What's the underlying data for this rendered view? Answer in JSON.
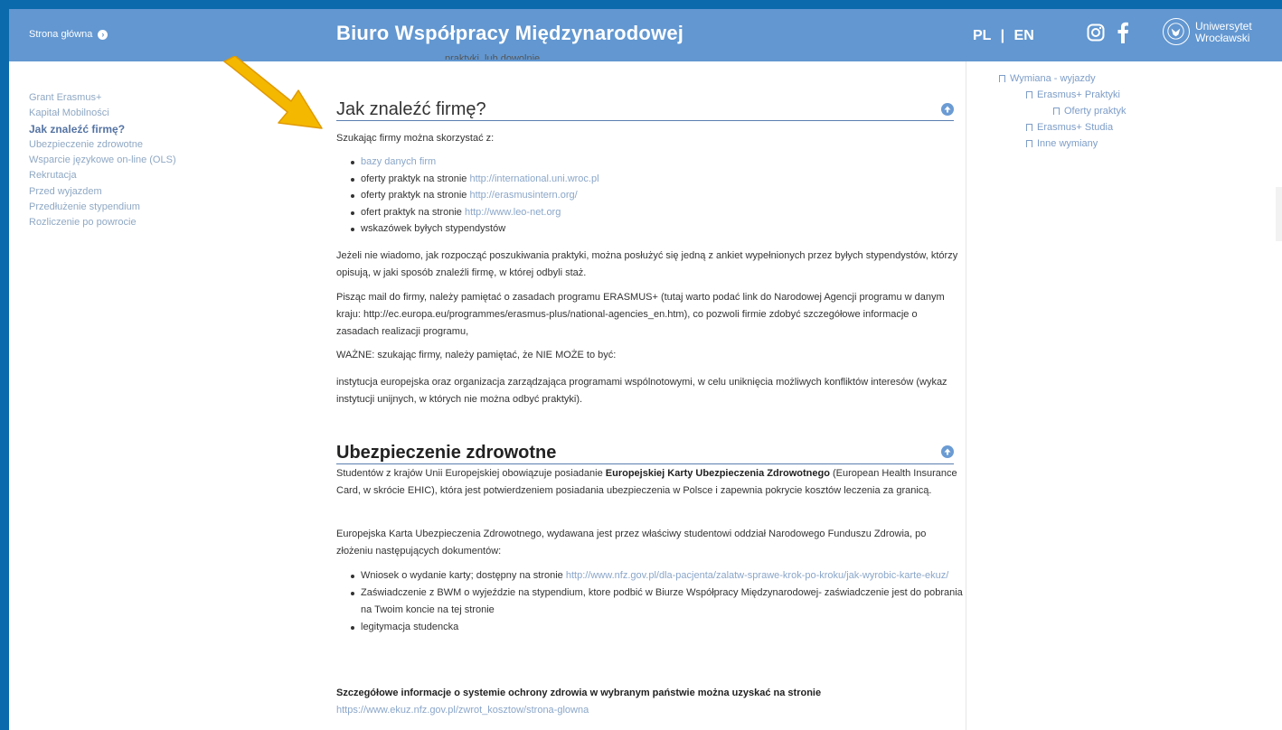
{
  "header": {
    "home_label": "Strona główna",
    "title": "Biuro Współpracy Międzynarodowej",
    "lang_pl": "PL",
    "lang_sep": "|",
    "lang_en": "EN",
    "university_line1": "Uniwersytet",
    "university_line2": "Wrocławski"
  },
  "sidebar": {
    "items": [
      {
        "label": "Grant Erasmus+"
      },
      {
        "label": "Kapitał Mobilności"
      },
      {
        "label": "Jak znaleźć firmę?"
      },
      {
        "label": "Ubezpieczenie zdrowotne"
      },
      {
        "label": "Wsparcie językowe on-line (OLS)"
      },
      {
        "label": "Rekrutacja"
      },
      {
        "label": "Przed wyjazdem"
      },
      {
        "label": "Przedłużenie stypendium"
      },
      {
        "label": "Rozliczenie po powrocie"
      }
    ]
  },
  "right_nav": {
    "items": [
      {
        "label": "Wymiana - wyjazdy"
      },
      {
        "label": "Erasmus+ Praktyki"
      },
      {
        "label": "Oferty praktyk"
      },
      {
        "label": "Erasmus+ Studia"
      },
      {
        "label": "Inne wymiany"
      }
    ]
  },
  "colors": {
    "accent": "#6297d1",
    "frame": "#0a6aab",
    "arrow": "#f5b800"
  },
  "main": {
    "top_cut_text": "praktyki, lub dowolnie",
    "section1": {
      "heading": "Jak znaleźć firmę?",
      "intro": "Szukając firmy można skorzystać z:",
      "list": [
        {
          "text": "",
          "link": "bazy danych firm"
        },
        {
          "text": "oferty praktyk na stronie ",
          "link": "http://international.uni.wroc.pl"
        },
        {
          "text": "oferty praktyk na stronie ",
          "link": "http://erasmusintern.org/"
        },
        {
          "text": "ofert praktyk na stronie ",
          "link": "http://www.leo-net.org"
        },
        {
          "text": "wskazówek byłych stypendystów",
          "link": ""
        }
      ],
      "p1": "Jeżeli nie wiadomo, jak rozpocząć poszukiwania praktyki, można posłużyć się jedną z ankiet wypełnionych przez byłych stypendystów, którzy opisują, w jaki sposób znaleźli firmę, w której odbyli staż.",
      "p2": "Pisząc mail do firmy, należy pamiętać o zasadach programu ERASMUS+ (tutaj warto podać link do Narodowej Agencji programu w danym kraju: http://ec.europa.eu/programmes/erasmus-plus/national-agencies_en.htm), co pozwoli firmie zdobyć szczegółowe informacje o zasadach realizacji programu,",
      "p3": "WAŻNE: szukając firmy, należy pamiętać, że NIE MOŻE to być:",
      "p4": "instytucja europejska oraz organizacja zarządzająca programami wspólnotowymi, w celu uniknięcia możliwych konfliktów interesów (wykaz instytucji unijnych, w których nie można odbyć praktyki)."
    },
    "section2": {
      "heading": "Ubezpieczenie zdrowotne",
      "p1_a": "Studentów z krajów Unii Europejskiej obowiązuje posiadanie ",
      "p1_b": "Europejskiej Karty Ubezpieczenia Zdrowotnego",
      "p1_c": " (European Health Insurance Card, w skrócie EHIC), która jest potwierdzeniem posiadania ubezpieczenia w Polsce i zapewnia pokrycie kosztów leczenia za granicą.",
      "p2": "Europejska Karta Ubezpieczenia Zdrowotnego, wydawana jest przez właściwy studentowi oddział Narodowego Funduszu Zdrowia, po złożeniu następujących dokumentów:",
      "list": [
        {
          "text": "Wniosek o wydanie karty; dostępny na stronie ",
          "link": "http://www.nfz.gov.pl/dla-pacjenta/zalatw-sprawe-krok-po-kroku/jak-wyrobic-karte-ekuz/"
        },
        {
          "text": "Zaświadczenie z BWM o wyjeździe na stypendium, ktore podbić w Biurze Współpracy Międzynarodowej- zaświadczenie jest do pobrania na Twoim koncie na tej stronie",
          "link": ""
        },
        {
          "text": "legitymacja studencka",
          "link": ""
        }
      ],
      "p3_bold": "Szczegółowe informacje o systemie ochrony zdrowia w wybranym państwie można uzyskać na stronie",
      "p3_link": "https://www.ekuz.nfz.gov.pl/zwrot_kosztow/strona-glowna"
    }
  }
}
